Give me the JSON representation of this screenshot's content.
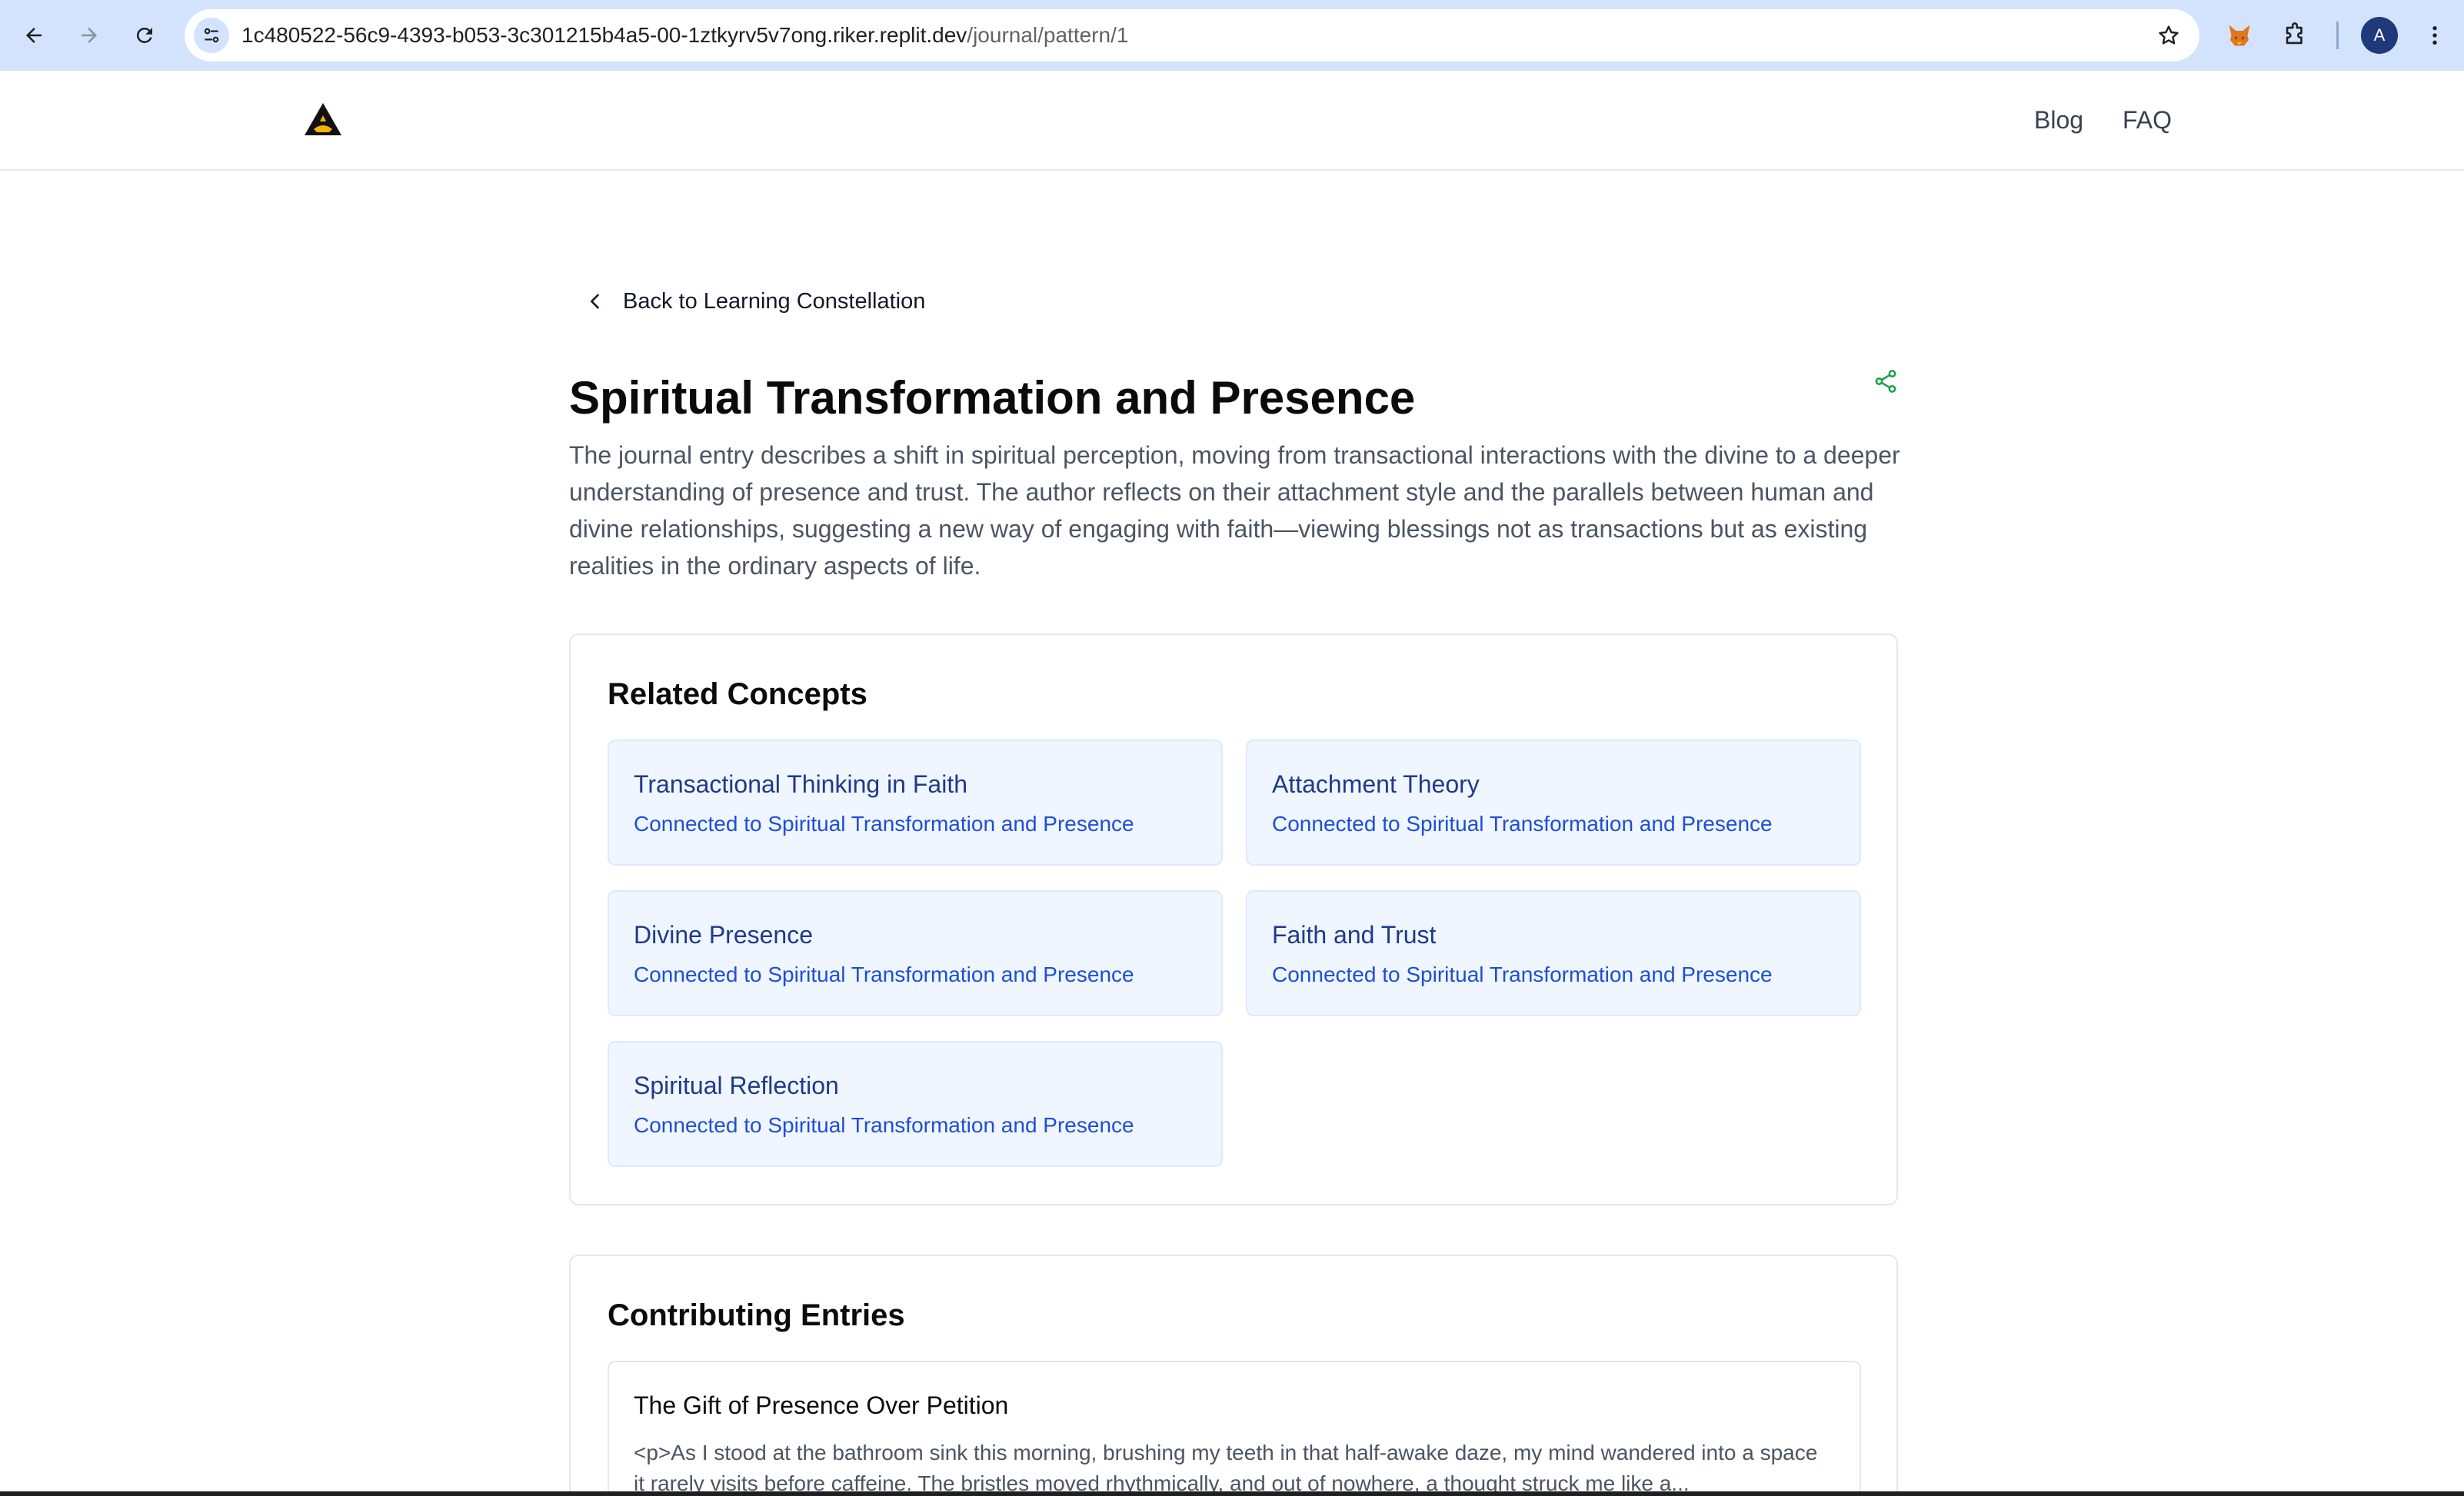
{
  "browser": {
    "url_host": "1c480522-56c9-4393-b053-3c301215b4a5-00-1ztkyrv5v7ong.riker.replit.dev",
    "url_path": "/journal/pattern/1",
    "icons": {
      "back": "arrow-left-icon",
      "forward": "arrow-right-icon",
      "reload": "reload-icon",
      "site_info": "tune-icon",
      "bookmark": "star-icon",
      "extension_1": "fox-extension-icon",
      "extensions": "puzzle-icon",
      "profile": "profile-avatar-icon",
      "menu": "kebab-menu-icon"
    },
    "profile_initial": "A"
  },
  "header": {
    "logo_icon": "triangle-logo-icon",
    "nav": [
      {
        "label": "Blog"
      },
      {
        "label": "FAQ"
      }
    ]
  },
  "main": {
    "back_label": "Back to Learning Constellation",
    "title": "Spiritual Transformation and Presence",
    "description": "The journal entry describes a shift in spiritual perception, moving from transactional interactions with the divine to a deeper understanding of presence and trust. The author reflects on their attachment style and the parallels between human and divine relationships, suggesting a new way of engaging with faith—viewing blessings not as transactions but as existing realities in the ordinary aspects of life.",
    "share_icon": "share-icon",
    "related": {
      "heading": "Related Concepts",
      "items": [
        {
          "name": "Transactional Thinking in Faith",
          "sub": "Connected to Spiritual Transformation and Presence"
        },
        {
          "name": "Attachment Theory",
          "sub": "Connected to Spiritual Transformation and Presence"
        },
        {
          "name": "Divine Presence",
          "sub": "Connected to Spiritual Transformation and Presence"
        },
        {
          "name": "Faith and Trust",
          "sub": "Connected to Spiritual Transformation and Presence"
        },
        {
          "name": "Spiritual Reflection",
          "sub": "Connected to Spiritual Transformation and Presence"
        }
      ]
    },
    "entries": {
      "heading": "Contributing Entries",
      "items": [
        {
          "title": "The Gift of Presence Over Petition",
          "excerpt": "<p>As I stood at the bathroom sink this morning, brushing my teeth in that half-awake daze, my mind wandered into a space it rarely visits before caffeine. The bristles moved rhythmically, and out of nowhere, a thought struck me like a..."
        }
      ]
    }
  },
  "colors": {
    "chrome_bg": "#d3e3fd",
    "concept_bg": "#eff6ff",
    "concept_title": "#1e3a8a",
    "concept_sub": "#1d4ed8",
    "share_green": "#16a34a",
    "logo_gold": "#f5b301"
  }
}
